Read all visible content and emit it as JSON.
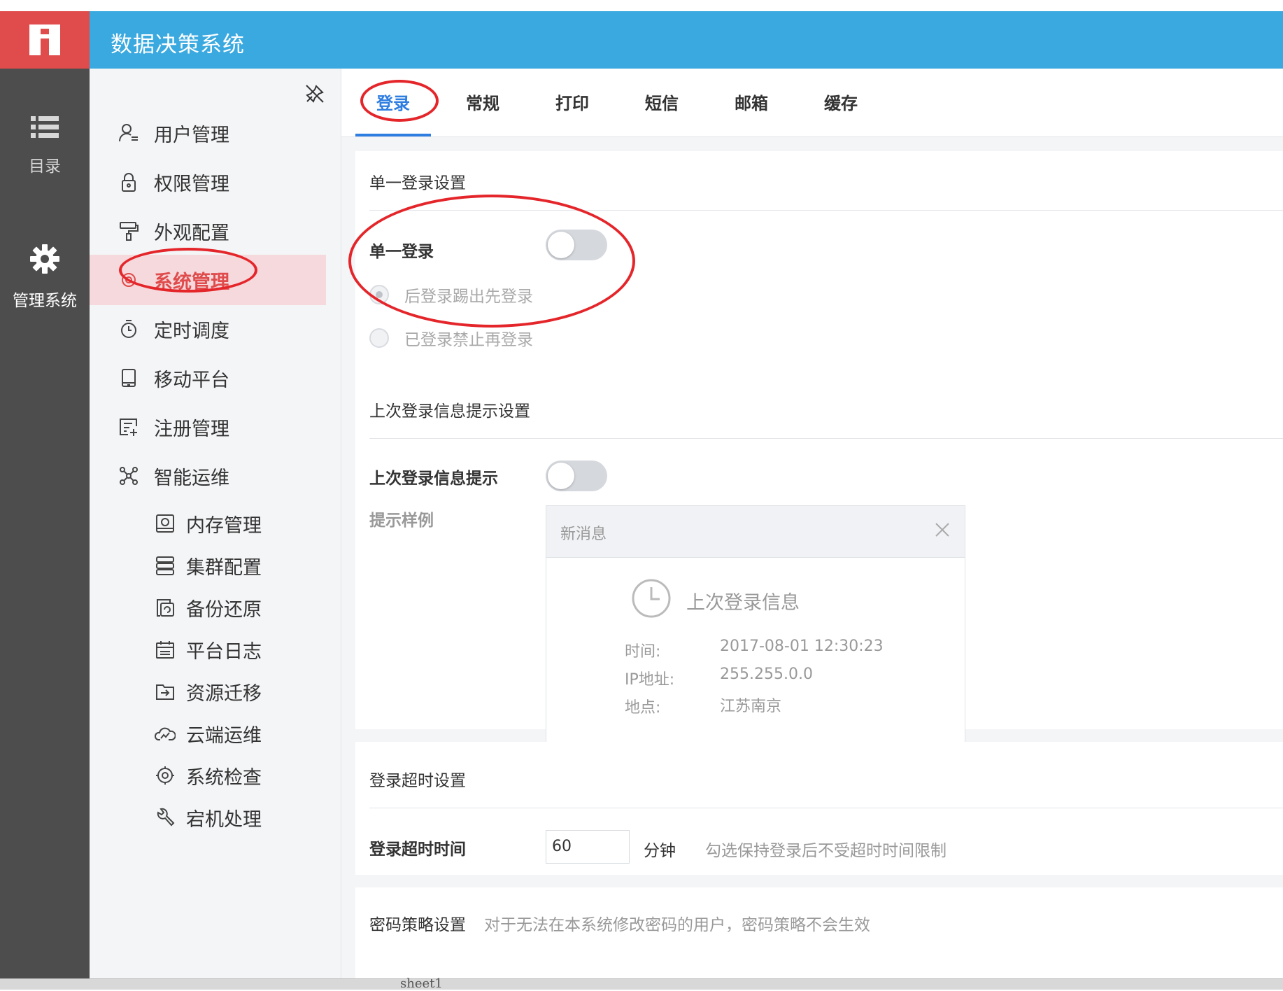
{
  "header": {
    "title": "数据决策系统"
  },
  "rail": {
    "items": [
      {
        "label": "目录",
        "icon": "list-icon"
      },
      {
        "label": "管理系统",
        "icon": "gear-icon"
      }
    ]
  },
  "menu": {
    "items": [
      {
        "label": "用户管理",
        "icon": "user-icon"
      },
      {
        "label": "权限管理",
        "icon": "lock-icon"
      },
      {
        "label": "外观配置",
        "icon": "paint-roller-icon"
      },
      {
        "label": "系统管理",
        "icon": "gear-icon"
      },
      {
        "label": "定时调度",
        "icon": "timer-icon"
      },
      {
        "label": "移动平台",
        "icon": "tablet-icon"
      },
      {
        "label": "注册管理",
        "icon": "register-icon"
      },
      {
        "label": "智能运维",
        "icon": "network-icon"
      }
    ],
    "subitems": [
      {
        "label": "内存管理",
        "icon": "memory-icon"
      },
      {
        "label": "集群配置",
        "icon": "cluster-icon"
      },
      {
        "label": "备份还原",
        "icon": "backup-icon"
      },
      {
        "label": "平台日志",
        "icon": "calendar-icon"
      },
      {
        "label": "资源迁移",
        "icon": "migrate-icon"
      },
      {
        "label": "云端运维",
        "icon": "cloud-chart-icon"
      },
      {
        "label": "系统检查",
        "icon": "gear-check-icon"
      },
      {
        "label": "宕机处理",
        "icon": "wrench-icon"
      }
    ]
  },
  "tabs": [
    "登录",
    "常规",
    "打印",
    "短信",
    "邮箱",
    "缓存"
  ],
  "sso": {
    "title": "单一登录设置",
    "label": "单一登录",
    "enabled": false,
    "options": [
      "后登录踢出先登录",
      "已登录禁止再登录"
    ],
    "selected_index": 0
  },
  "last_login": {
    "title": "上次登录信息提示设置",
    "label": "上次登录信息提示",
    "enabled": false,
    "sample_label": "提示样例",
    "notice": {
      "header": "新消息",
      "subtitle": "上次登录信息",
      "rows": [
        {
          "key": "时间:",
          "value": "2017-08-01 12:30:23"
        },
        {
          "key": "IP地址:",
          "value": "255.255.0.0"
        },
        {
          "key": "地点:",
          "value": "江苏南京"
        }
      ]
    }
  },
  "timeout": {
    "title": "登录超时设置",
    "label": "登录超时时间",
    "value": "60",
    "unit": "分钟",
    "hint": "勾选保持登录后不受超时时间限制"
  },
  "password_policy": {
    "title": "密码策略设置",
    "hint": "对于无法在本系统修改密码的用户，密码策略不会生效"
  },
  "taskbar": {
    "label": "sheet1"
  },
  "colors": {
    "header": "#3aa9e0",
    "logo": "#e04b4b",
    "rail": "#4d4d4d",
    "active": "#e04b4b",
    "tab_active": "#2e7de0",
    "annotation": "#e4262b"
  }
}
